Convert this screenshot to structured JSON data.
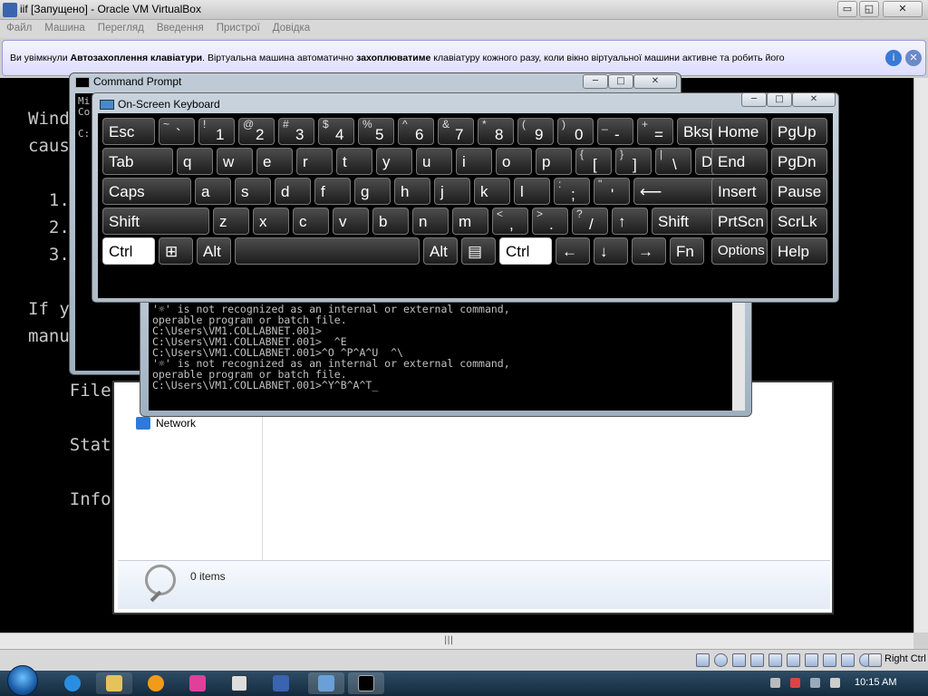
{
  "vbox": {
    "title": "iif [Запущено] - Oracle VM VirtualBox",
    "controls": {
      "minimize": "▭",
      "restore": "◱",
      "close": "✕"
    },
    "menu": [
      "Файл",
      "Машина",
      "Перегляд",
      "Введення",
      "Пристрої",
      "Довідка"
    ],
    "notice": {
      "text_a": "Ви увімкнули ",
      "bold_a": "Автозахоплення клавіатури",
      "text_b": ". Віртуальна машина автоматично ",
      "bold_b": "захоплюватиме",
      "text_c": " клавіатуру кожного разу, коли вікно віртуальної машини активне та робить його"
    },
    "status_host_key": "Right Ctrl"
  },
  "guest_background_text": {
    "l1": "Wind",
    "l2": "caus",
    "l3": "  1.",
    "l4": "  2.",
    "l5": "  3.",
    "l6": "If y",
    "l7": "manu",
    "l8": "    File",
    "l9": "    Stat",
    "l10": "    Info"
  },
  "cmd_back": {
    "title": "Command Prompt",
    "lines": [
      "Mi",
      "Co",
      "C:"
    ]
  },
  "cmd_front": {
    "lines": [
      "'☼' is not recognized as an internal or external command,",
      "operable program or batch file.",
      "",
      "C:\\Users\\VM1.COLLABNET.001>",
      "C:\\Users\\VM1.COLLABNET.001>  ^E",
      "C:\\Users\\VM1.COLLABNET.001>^O ^P^A^U  ^\\",
      "'☼' is not recognized as an internal or external command,",
      "operable program or batch file.",
      "",
      "C:\\Users\\VM1.COLLABNET.001>^Y^B^A^T_"
    ]
  },
  "explorer": {
    "network_label": "Network",
    "items_count": "0 items"
  },
  "osk": {
    "title": "On-Screen Keyboard",
    "row1": [
      {
        "m": "Esc"
      },
      {
        "s": "~",
        "b": "`"
      },
      {
        "s": "!",
        "b": "1"
      },
      {
        "s": "@",
        "b": "2"
      },
      {
        "s": "#",
        "b": "3"
      },
      {
        "s": "$",
        "b": "4"
      },
      {
        "s": "%",
        "b": "5"
      },
      {
        "s": "^",
        "b": "6"
      },
      {
        "s": "&",
        "b": "7"
      },
      {
        "s": "*",
        "b": "8"
      },
      {
        "s": "(",
        "b": "9"
      },
      {
        "s": ")",
        "b": "0"
      },
      {
        "s": "_",
        "b": "-"
      },
      {
        "s": "+",
        "b": "="
      },
      {
        "m": "Bksp"
      },
      {
        "m": "Home"
      },
      {
        "m": "PgUp"
      }
    ],
    "row2": [
      {
        "m": "Tab"
      },
      {
        "m": "q"
      },
      {
        "m": "w"
      },
      {
        "m": "e"
      },
      {
        "m": "r"
      },
      {
        "m": "t"
      },
      {
        "m": "y"
      },
      {
        "m": "u"
      },
      {
        "m": "i"
      },
      {
        "m": "o"
      },
      {
        "m": "p"
      },
      {
        "s": "{",
        "b": "["
      },
      {
        "s": "}",
        "b": "]"
      },
      {
        "s": "|",
        "b": "\\"
      },
      {
        "m": "Del"
      },
      {
        "m": "End"
      },
      {
        "m": "PgDn"
      }
    ],
    "row3": [
      {
        "m": "Caps"
      },
      {
        "m": "a"
      },
      {
        "m": "s"
      },
      {
        "m": "d"
      },
      {
        "m": "f"
      },
      {
        "m": "g"
      },
      {
        "m": "h"
      },
      {
        "m": "j"
      },
      {
        "m": "k"
      },
      {
        "m": "l"
      },
      {
        "s": ":",
        "b": ";"
      },
      {
        "s": "\"",
        "b": "'"
      },
      {
        "m": "⟵"
      },
      {
        "m": "Insert"
      },
      {
        "m": "Pause"
      }
    ],
    "row4": [
      {
        "m": "Shift"
      },
      {
        "m": "z"
      },
      {
        "m": "x"
      },
      {
        "m": "c"
      },
      {
        "m": "v"
      },
      {
        "m": "b"
      },
      {
        "m": "n"
      },
      {
        "m": "m"
      },
      {
        "s": "<",
        "b": ","
      },
      {
        "s": ">",
        "b": "."
      },
      {
        "s": "?",
        "b": "/"
      },
      {
        "m": "↑"
      },
      {
        "m": "Shift"
      },
      {
        "m": "PrtScn"
      },
      {
        "m": "ScrLk"
      }
    ],
    "row5": [
      {
        "m": "Ctrl",
        "on": true
      },
      {
        "m": "⊞"
      },
      {
        "m": "Alt"
      },
      {
        "m": ""
      },
      {
        "m": "Alt"
      },
      {
        "m": "▤"
      },
      {
        "m": "Ctrl",
        "on": true
      },
      {
        "m": "←"
      },
      {
        "m": "↓"
      },
      {
        "m": "→"
      },
      {
        "m": "Fn"
      },
      {
        "m": "Options"
      },
      {
        "m": "Help"
      }
    ]
  },
  "taskbar": {
    "clock": "10:15 AM"
  },
  "colors": {
    "accent": "#2f7ad9",
    "taskbar": "#1f3a52"
  }
}
